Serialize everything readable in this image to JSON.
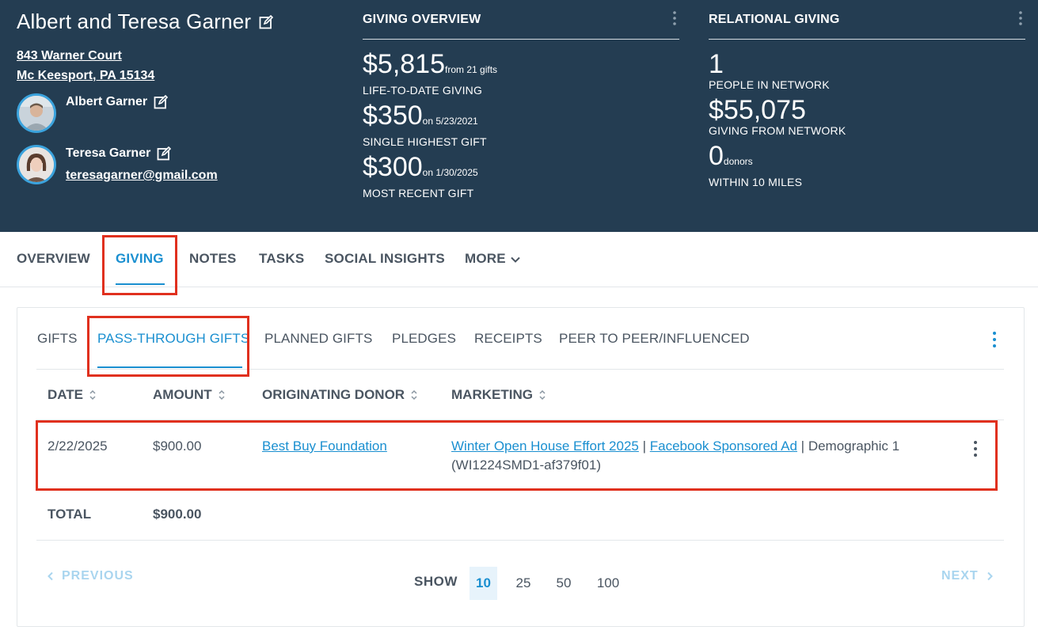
{
  "header": {
    "donor_name": "Albert and Teresa Garner",
    "address_line1": "843 Warner Court",
    "address_line2": "Mc Keesport, PA 15134",
    "people": [
      {
        "name": "Albert Garner",
        "email": ""
      },
      {
        "name": "Teresa Garner",
        "email": "teresagarner@gmail.com"
      }
    ]
  },
  "giving_overview": {
    "title": "GIVING OVERVIEW",
    "lifetime_value": "$5,815",
    "lifetime_suffix": "from 21 gifts",
    "lifetime_label": "LIFE-TO-DATE GIVING",
    "highest_value": "$350",
    "highest_suffix": "on 5/23/2021",
    "highest_label": "SINGLE HIGHEST GIFT",
    "recent_value": "$300",
    "recent_suffix": "on 1/30/2025",
    "recent_label": "MOST RECENT GIFT"
  },
  "relational_giving": {
    "title": "RELATIONAL GIVING",
    "people_value": "1",
    "people_label": "PEOPLE IN NETWORK",
    "network_value": "$55,075",
    "network_label": "GIVING FROM NETWORK",
    "nearby_value": "0",
    "nearby_suffix": "donors",
    "nearby_label": "WITHIN 10 MILES"
  },
  "main_tabs": {
    "overview": "OVERVIEW",
    "giving": "GIVING",
    "notes": "NOTES",
    "tasks": "TASKS",
    "social": "SOCIAL INSIGHTS",
    "more": "MORE",
    "active": "GIVING"
  },
  "sub_tabs": {
    "gifts": "GIFTS",
    "pass_through": "PASS-THROUGH GIFTS",
    "planned": "PLANNED GIFTS",
    "pledges": "PLEDGES",
    "receipts": "RECEIPTS",
    "peer": "PEER TO PEER/INFLUENCED",
    "active": "PASS-THROUGH GIFTS"
  },
  "table": {
    "columns": {
      "date": "DATE",
      "amount": "AMOUNT",
      "donor": "ORIGINATING DONOR",
      "marketing": "MARKETING"
    },
    "rows": [
      {
        "date": "2/22/2025",
        "amount": "$900.00",
        "donor": "Best Buy Foundation",
        "marketing_link1": "Winter Open House Effort 2025",
        "separator1": " | ",
        "marketing_link2": "Facebook Sponsored Ad",
        "separator2": " | ",
        "marketing_text": "Demographic 1",
        "marketing_code": "(WI1224SMD1-af379f01)"
      }
    ],
    "total_label": "TOTAL",
    "total_value": "$900.00"
  },
  "pagination": {
    "previous": "PREVIOUS",
    "next": "NEXT",
    "show_label": "SHOW",
    "sizes": [
      "10",
      "25",
      "50",
      "100"
    ],
    "selected": "10"
  },
  "colors": {
    "header_bg": "#243d52",
    "accent": "#1a8fd0",
    "highlight": "#e0301e"
  }
}
